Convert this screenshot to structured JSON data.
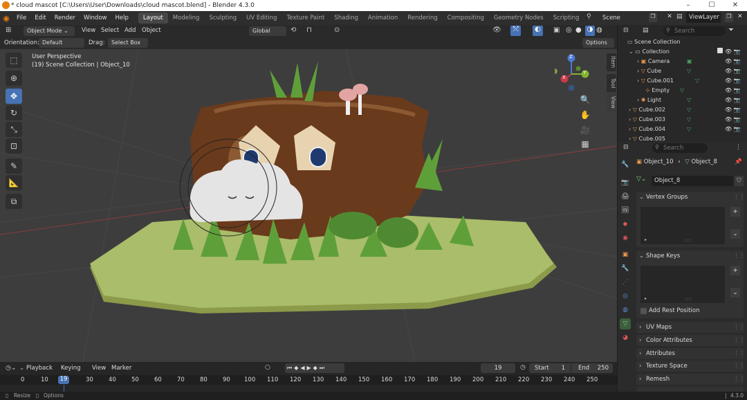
{
  "window": {
    "title": "* cloud mascot [C:\\Users\\User\\Downloads\\cloud mascot.blend] - Blender 4.3.0",
    "minimize": "–",
    "maximize": "☐",
    "close": "✕"
  },
  "menubar": {
    "items": [
      "File",
      "Edit",
      "Render",
      "Window",
      "Help"
    ]
  },
  "workspaces": {
    "tabs": [
      "Layout",
      "Modeling",
      "Sculpting",
      "UV Editing",
      "Texture Paint",
      "Shading",
      "Animation",
      "Rendering",
      "Compositing",
      "Geometry Nodes",
      "Scripting"
    ],
    "active": "Layout"
  },
  "scene": {
    "name": "Scene",
    "view_layer": "ViewLayer"
  },
  "viewport_header": {
    "mode": "Object Mode",
    "menus": [
      "View",
      "Select",
      "Add",
      "Object"
    ],
    "transform": "Global"
  },
  "tool_settings": {
    "orientation_label": "Orientation:",
    "orientation_value": "Default",
    "drag_label": "Drag:",
    "drag_value": "Select Box",
    "options": "Options"
  },
  "viewport": {
    "perspective": "User Perspective",
    "collection_info": "(19) Scene Collection | Object_10"
  },
  "gizmo": {
    "x": "X",
    "y": "Y",
    "z": "Z"
  },
  "side_tabs": [
    "Item",
    "Tool",
    "View"
  ],
  "outliner": {
    "search_placeholder": "Search",
    "root": "Scene Collection",
    "items": [
      {
        "name": "Collection",
        "indent": 1
      },
      {
        "name": "Camera",
        "indent": 2
      },
      {
        "name": "Cube",
        "indent": 2
      },
      {
        "name": "Cube.001",
        "indent": 2
      },
      {
        "name": "Empty",
        "indent": 2
      },
      {
        "name": "Light",
        "indent": 2
      },
      {
        "name": "Cube.002",
        "indent": 1
      },
      {
        "name": "Cube.003",
        "indent": 1
      },
      {
        "name": "Cube.004",
        "indent": 1
      },
      {
        "name": "Cube.005",
        "indent": 1
      }
    ]
  },
  "properties": {
    "search_placeholder": "Search",
    "breadcrumb_object": "Object_10",
    "breadcrumb_data": "Object_8",
    "mesh_name": "Object_8",
    "panels": {
      "vertex_groups": "Vertex Groups",
      "shape_keys": "Shape Keys",
      "add_rest_position": "Add Rest Position",
      "uv_maps": "UV Maps",
      "color_attributes": "Color Attributes",
      "attributes": "Attributes",
      "texture_space": "Texture Space",
      "remesh": "Remesh"
    }
  },
  "timeline": {
    "menus": [
      "Playback",
      "Keying",
      "View",
      "Marker"
    ],
    "current_frame": "19",
    "start_label": "Start",
    "start": "1",
    "end_label": "End",
    "end": "250",
    "ruler": [
      "0",
      "10",
      "19",
      "30",
      "40",
      "50",
      "60",
      "70",
      "80",
      "90",
      "100",
      "110",
      "120",
      "130",
      "140",
      "150",
      "160",
      "170",
      "180",
      "190",
      "200",
      "210",
      "220",
      "230",
      "240",
      "250"
    ]
  },
  "statusbar": {
    "resize": "Resize",
    "options": "Options",
    "version": "4.3.0"
  }
}
